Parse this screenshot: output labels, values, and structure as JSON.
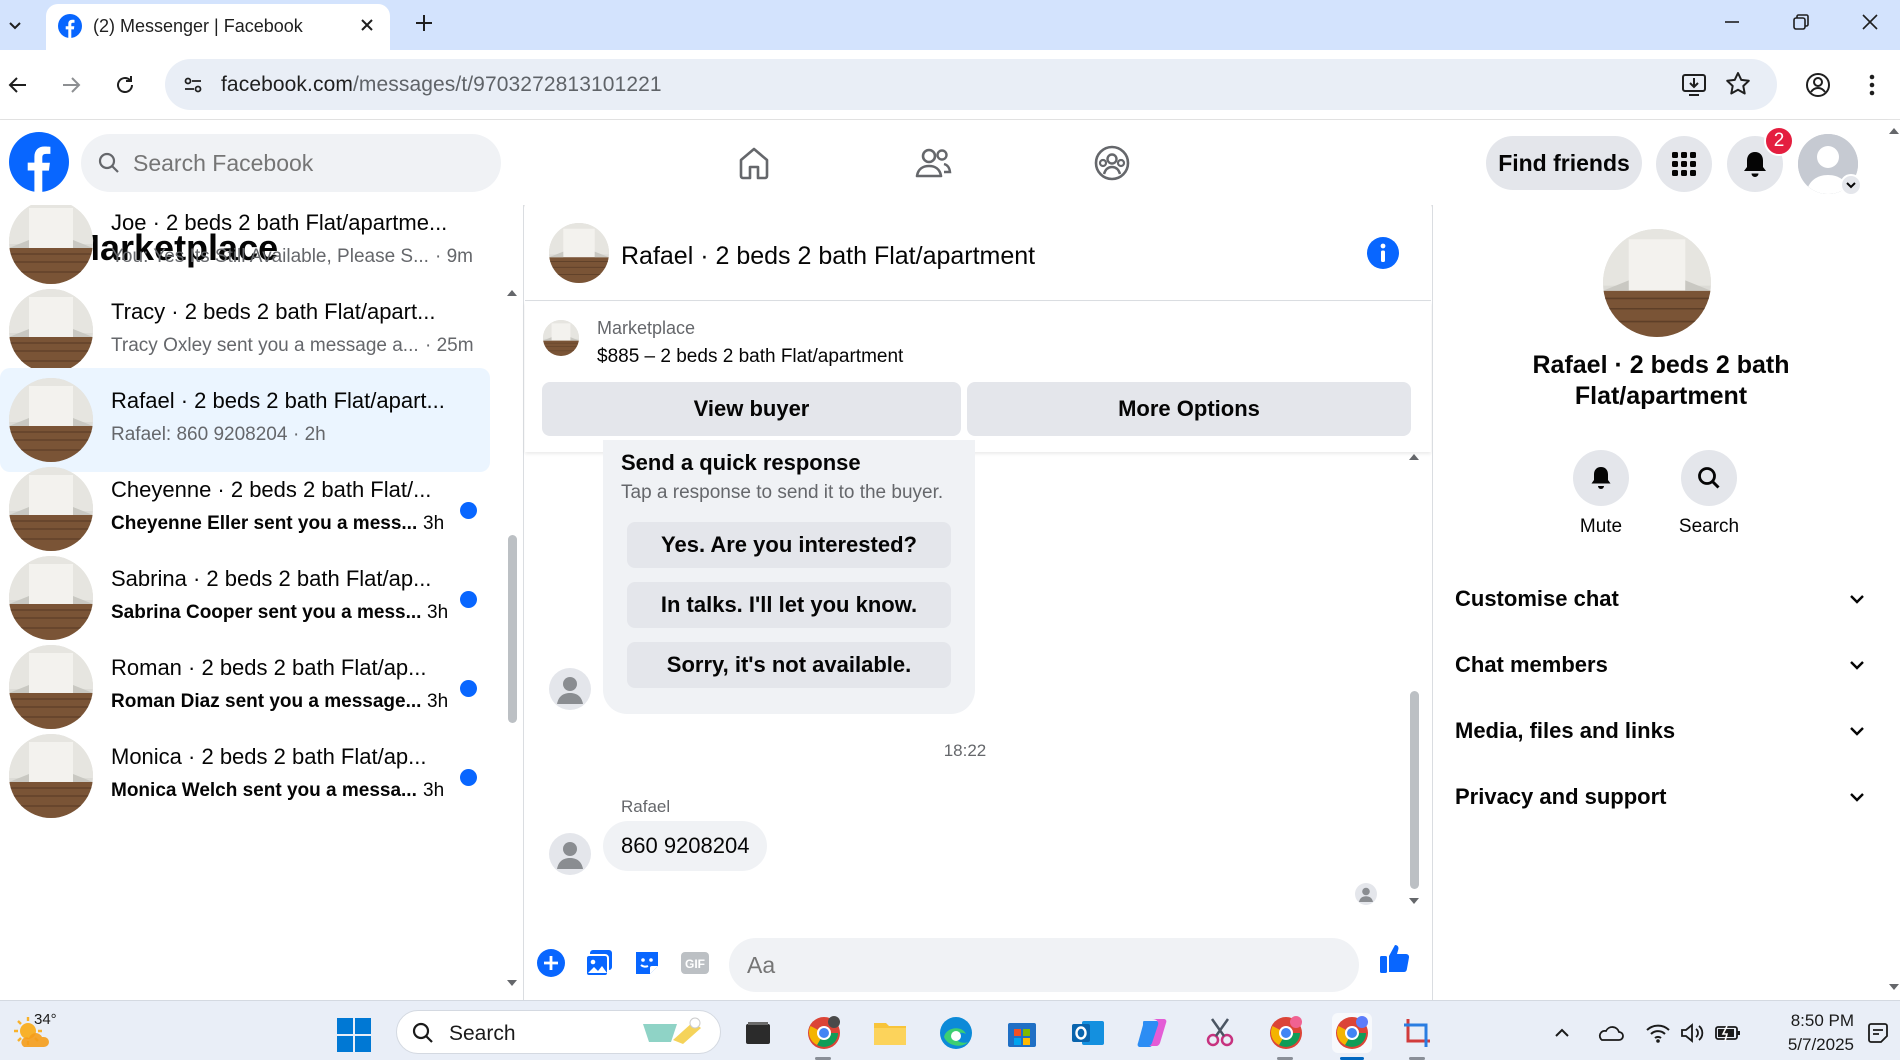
{
  "browser": {
    "tab_title": "(2) Messenger | Facebook",
    "url_domain": "facebook.com",
    "url_path": "/messages/t/9703272813101221",
    "accent": "#d3e3fd"
  },
  "fb": {
    "search_placeholder": "Search Facebook",
    "find_friends": "Find friends",
    "notification_count": "2",
    "brand_color": "#0866ff"
  },
  "left": {
    "title": "Marketplace",
    "conversations": [
      {
        "name": "Joe · 2 beds 2 bath Flat/apartme...",
        "snippet": "You: Yes Its Still Available, Please S...",
        "time": "· 9m",
        "unread": false,
        "selected": false
      },
      {
        "name": "Tracy · 2 beds 2 bath Flat/apart...",
        "snippet": "Tracy Oxley sent you a message a...",
        "time": "· 25m",
        "unread": false,
        "selected": false
      },
      {
        "name": "Rafael · 2 beds 2 bath Flat/apart...",
        "snippet": "Rafael: 860 9208204",
        "time": "· 2h",
        "unread": false,
        "selected": true
      },
      {
        "name": "Cheyenne · 2 beds 2 bath Flat/...",
        "snippet": "Cheyenne Eller sent you a mess...",
        "time": "3h",
        "unread": true,
        "selected": false
      },
      {
        "name": "Sabrina · 2 beds 2 bath Flat/ap...",
        "snippet": "Sabrina Cooper sent you a mess...",
        "time": "3h",
        "unread": true,
        "selected": false
      },
      {
        "name": "Roman · 2 beds 2 bath Flat/ap...",
        "snippet": "Roman Diaz sent you a message...",
        "time": "3h",
        "unread": true,
        "selected": false
      },
      {
        "name": "Monica · 2 beds 2 bath Flat/ap...",
        "snippet": "Monica Welch sent you a messa...",
        "time": "3h",
        "unread": true,
        "selected": false
      }
    ]
  },
  "chat": {
    "title": "Rafael · 2 beds 2 bath Flat/apartment",
    "marketplace_label": "Marketplace",
    "listing": "$885 – 2 beds 2 bath Flat/apartment",
    "view_buyer": "View buyer",
    "more_options": "More Options",
    "quick_title": "Send a quick response",
    "quick_sub": "Tap a response to send it to the buyer.",
    "quick_replies": [
      "Yes. Are you interested?",
      "In talks. I'll let you know.",
      "Sorry, it's not available."
    ],
    "timestamp": "18:22",
    "sender": "Rafael",
    "message": "860 9208204",
    "input_placeholder": "Aa"
  },
  "right": {
    "name": "Rafael · 2 beds 2 bath Flat/apartment",
    "mute": "Mute",
    "search": "Search",
    "sections": [
      "Customise chat",
      "Chat members",
      "Media, files and links",
      "Privacy and support"
    ]
  },
  "taskbar": {
    "temperature": "34°",
    "search": "Search",
    "time": "8:50 PM",
    "date": "5/7/2025"
  }
}
